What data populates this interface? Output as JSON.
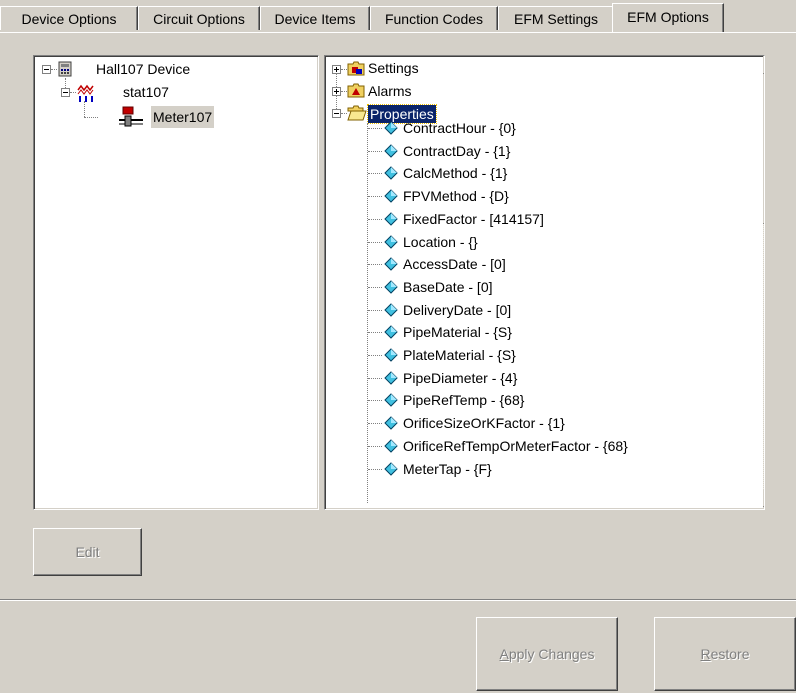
{
  "tabs": [
    {
      "label": "Device Options",
      "active": false
    },
    {
      "label": "Circuit Options",
      "active": false
    },
    {
      "label": "Device Items",
      "active": false
    },
    {
      "label": "Function Codes",
      "active": false
    },
    {
      "label": "EFM Settings",
      "active": false
    },
    {
      "label": "EFM Options",
      "active": true
    }
  ],
  "device_tree": {
    "root": "Hall107 Device",
    "station": "stat107",
    "meter": "Meter107"
  },
  "options_tree": {
    "settings": "Settings",
    "alarms": "Alarms",
    "properties": "Properties",
    "property_items": [
      "ContractHour - {0}",
      "ContractDay - {1}",
      "CalcMethod - {1}",
      "FPVMethod - {D}",
      "FixedFactor - [414157]",
      "Location - {}",
      "AccessDate - [0]",
      "BaseDate - [0]",
      "DeliveryDate - [0]",
      "PipeMaterial - {S}",
      "PlateMaterial - {S}",
      "PipeDiameter - {4}",
      "PipeRefTemp - {68}",
      "OrificeSizeOrKFactor - {1}",
      "OrificeRefTempOrMeterFactor - {68}",
      "MeterTap - {F}"
    ]
  },
  "buttons": {
    "edit": "Edit",
    "apply_first": "A",
    "apply_rest": "pply Changes",
    "restore_first": "R",
    "restore_rest": "estore"
  },
  "colors": {
    "face": "#d4d0c8",
    "selection": "#0a246a"
  }
}
